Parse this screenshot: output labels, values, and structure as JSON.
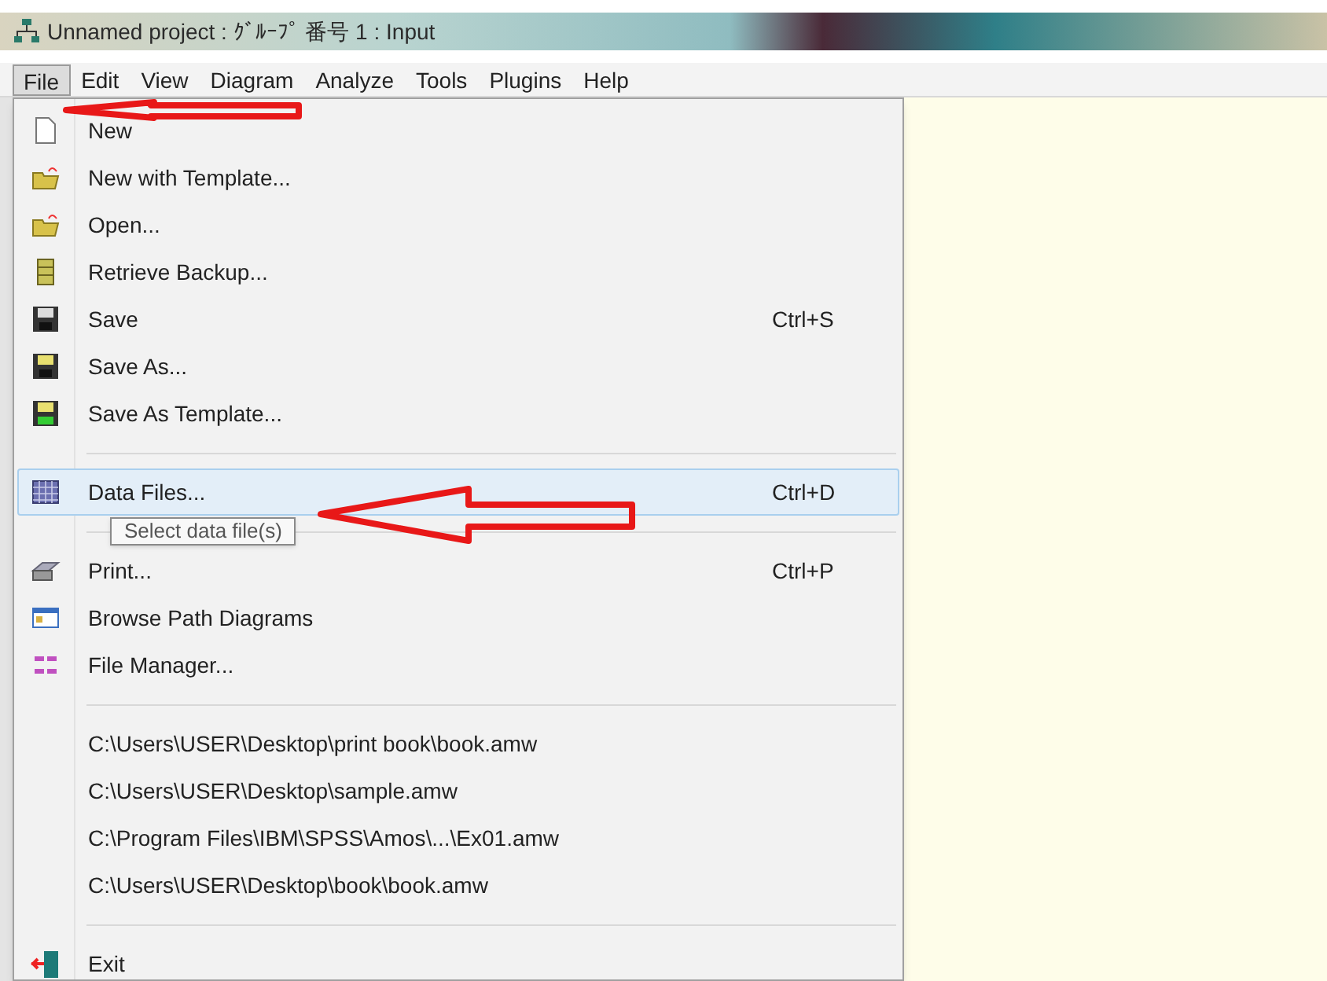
{
  "window": {
    "title": "Unnamed project : ｸﾞﾙｰﾌﾟ 番号 1 : Input"
  },
  "menubar": [
    {
      "label": "File",
      "selected": true
    },
    {
      "label": "Edit",
      "selected": false
    },
    {
      "label": "View",
      "selected": false
    },
    {
      "label": "Diagram",
      "selected": false
    },
    {
      "label": "Analyze",
      "selected": false
    },
    {
      "label": "Tools",
      "selected": false
    },
    {
      "label": "Plugins",
      "selected": false
    },
    {
      "label": "Help",
      "selected": false
    }
  ],
  "file_menu": [
    {
      "kind": "item",
      "label": "New",
      "highlighted": false
    },
    {
      "kind": "item",
      "label": "New with Template...",
      "highlighted": false
    },
    {
      "kind": "item",
      "label": "Open...",
      "highlighted": false
    },
    {
      "kind": "item",
      "label": "Retrieve Backup...",
      "highlighted": false
    },
    {
      "kind": "item",
      "label": "Save",
      "shortcut": "Ctrl+S",
      "highlighted": false
    },
    {
      "kind": "item",
      "label": "Save As...",
      "highlighted": false
    },
    {
      "kind": "item",
      "label": "Save As  Template...",
      "highlighted": false
    },
    {
      "kind": "separator"
    },
    {
      "kind": "item",
      "label": "Data Files...",
      "shortcut": "Ctrl+D",
      "highlighted": true
    },
    {
      "kind": "separator"
    },
    {
      "kind": "item",
      "label": "Print...",
      "shortcut": "Ctrl+P",
      "highlighted": false
    },
    {
      "kind": "item",
      "label": "Browse Path Diagrams",
      "highlighted": false
    },
    {
      "kind": "item",
      "label": "File Manager...",
      "highlighted": false
    },
    {
      "kind": "separator"
    },
    {
      "kind": "recent",
      "label": "C:\\Users\\USER\\Desktop\\print book\\book.amw"
    },
    {
      "kind": "recent",
      "label": "C:\\Users\\USER\\Desktop\\sample.amw"
    },
    {
      "kind": "recent",
      "label": "C:\\Program Files\\IBM\\SPSS\\Amos\\...\\Ex01.amw"
    },
    {
      "kind": "recent",
      "label": "C:\\Users\\USER\\Desktop\\book\\book.amw"
    },
    {
      "kind": "separator"
    },
    {
      "kind": "item",
      "label": "Exit",
      "highlighted": false
    }
  ],
  "tooltip": {
    "text": "Select data file(s)"
  }
}
